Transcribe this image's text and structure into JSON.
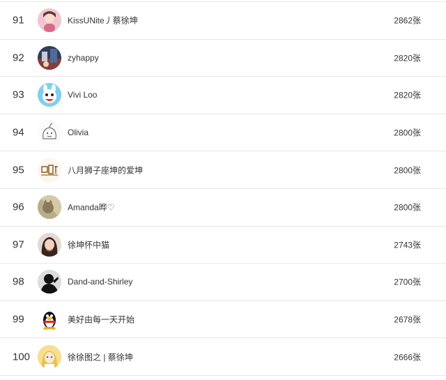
{
  "rows": [
    {
      "rank": "91",
      "name": "KissUNite丿蔡徐坤",
      "count": "2862张",
      "avatar": "avatar-pink-girl"
    },
    {
      "rank": "92",
      "name": "zyhappy",
      "count": "2820张",
      "avatar": "avatar-city-photo"
    },
    {
      "rank": "93",
      "name": " Vivi Loo",
      "count": "2820张",
      "avatar": "avatar-cartoon-bunny"
    },
    {
      "rank": "94",
      "name": "Olivia",
      "count": "2800张",
      "avatar": "avatar-sketch-face"
    },
    {
      "rank": "95",
      "name": "八月狮子座坤的爱坤",
      "count": "2800张",
      "avatar": "avatar-doodle-text"
    },
    {
      "rank": "96",
      "name": "Amanda晔♡",
      "count": "2800张",
      "avatar": "avatar-cat-photo"
    },
    {
      "rank": "97",
      "name": "徐坤怀中猫",
      "count": "2743张",
      "avatar": "avatar-girl-portrait"
    },
    {
      "rank": "98",
      "name": "Dand-and-Shirley",
      "count": "2700张",
      "avatar": "avatar-silhouette"
    },
    {
      "rank": "99",
      "name": "美好由每一天开始",
      "count": "2678张",
      "avatar": "avatar-qq-penguin"
    },
    {
      "rank": "100",
      "name": "徐徐图之 | 蔡徐坤",
      "count": "2666张",
      "avatar": "avatar-anime-yellow"
    }
  ]
}
